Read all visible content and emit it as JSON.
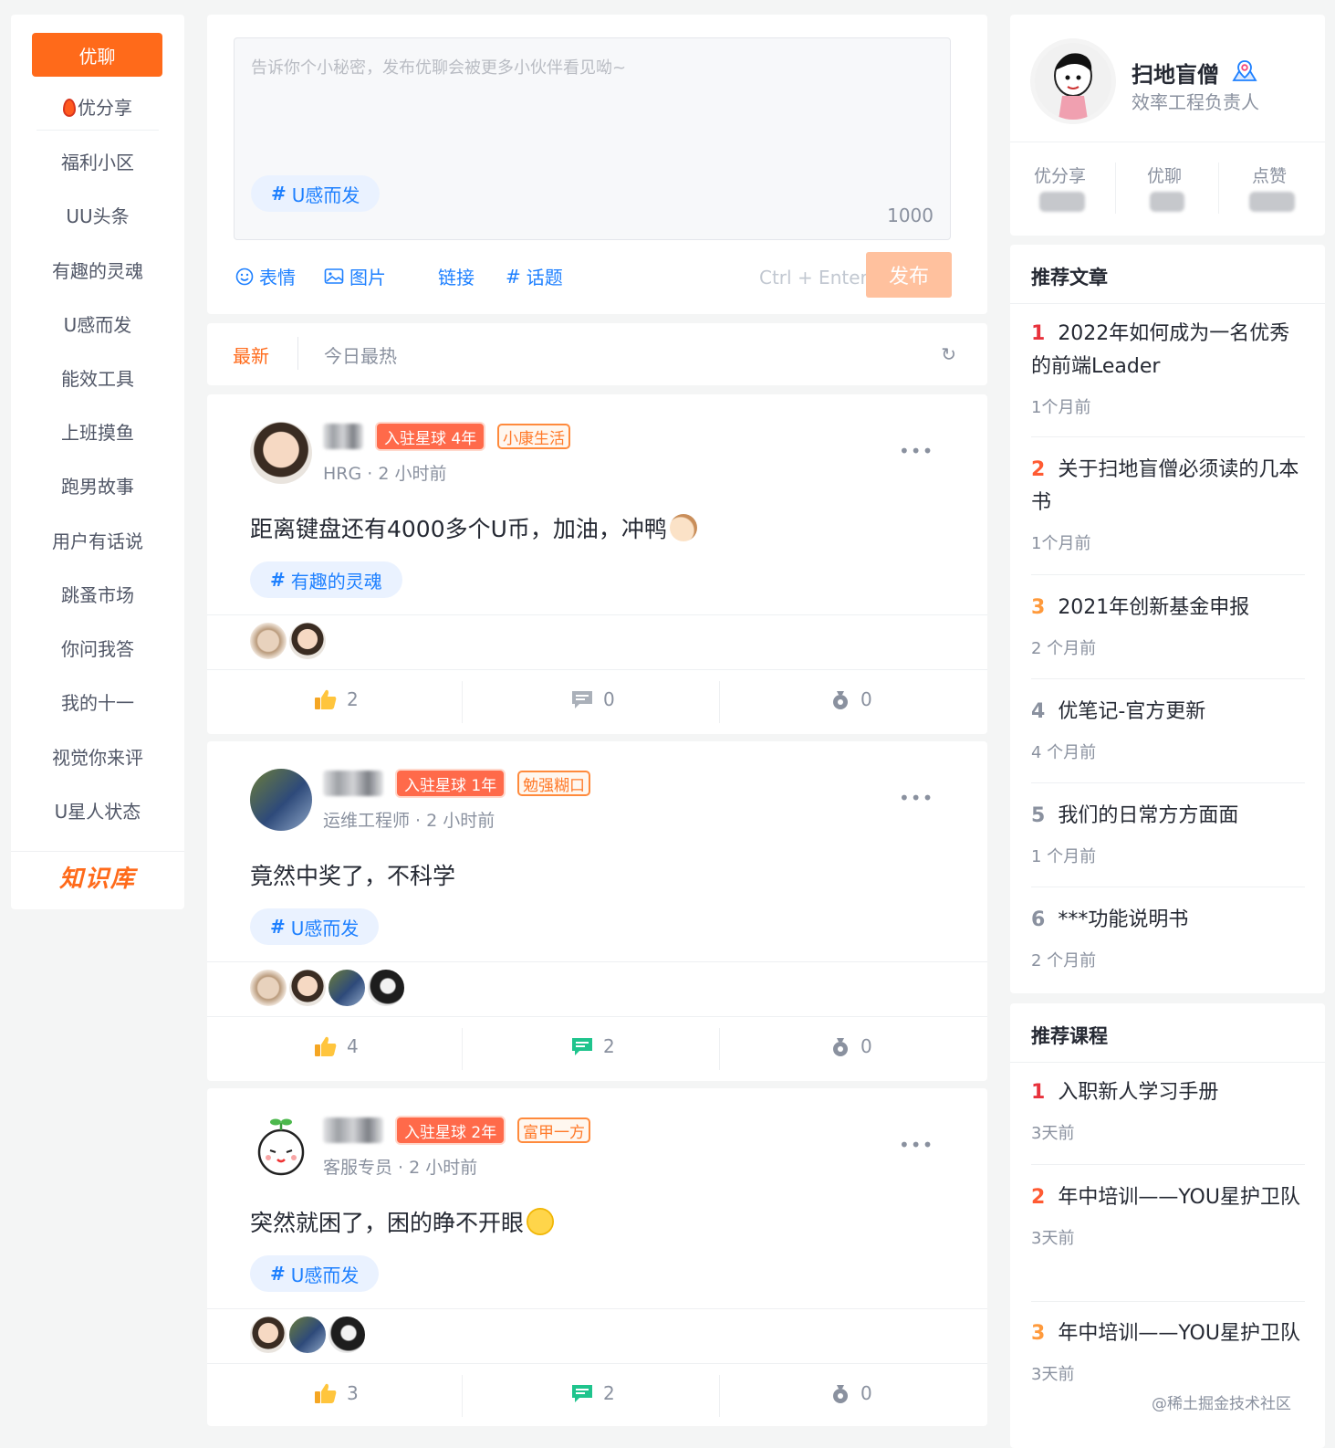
{
  "nav": {
    "active": "优聊",
    "items": [
      "优分享",
      "福利小区",
      "UU头条",
      "有趣的灵魂",
      "U感而发",
      "能效工具",
      "上班摸鱼",
      "跑男故事",
      "用户有话说",
      "跳蚤市场",
      "你问我答",
      "我的十一",
      "视觉你来评",
      "U星人状态"
    ],
    "knowledge_base": "知识库"
  },
  "composer": {
    "placeholder": "告诉你个小秘密，发布优聊会被更多小伙伴看见呦~",
    "topic": "U感而发",
    "char_count": "1000",
    "tools": [
      "表情",
      "图片",
      "链接",
      "话题"
    ],
    "shortcut": "Ctrl + Enter",
    "publish": "发布"
  },
  "tabs": {
    "active": "最新",
    "other": "今日最热"
  },
  "posts": [
    {
      "badge_years": "入驻星球 4年",
      "badge_level": "小康生活",
      "role": "HRG",
      "time": "2 小时前",
      "content": "距离键盘还有4000多个U币，加油，冲鸭",
      "topic": "有趣的灵魂",
      "likes": "2",
      "comments": "0",
      "shares": "0"
    },
    {
      "badge_years": "入驻星球 1年",
      "badge_level": "勉强糊口",
      "role": "运维工程师",
      "time": "2 小时前",
      "content": "竟然中奖了，不科学",
      "topic": "U感而发",
      "likes": "4",
      "comments": "2",
      "shares": "0"
    },
    {
      "badge_years": "入驻星球 2年",
      "badge_level": "富甲一方",
      "role": "客服专员",
      "time": "2 小时前",
      "content": "突然就困了，困的睁不开眼",
      "topic": "U感而发",
      "likes": "3",
      "comments": "2",
      "shares": "0"
    }
  ],
  "profile": {
    "name": "扫地盲僧",
    "title": "效率工程负责人",
    "stats": [
      "优分享",
      "优聊",
      "点赞"
    ]
  },
  "recommended_articles": {
    "title": "推荐文章",
    "items": [
      {
        "rank": "1",
        "title": "2022年如何成为一名优秀的前端Leader",
        "time": "1个月前"
      },
      {
        "rank": "2",
        "title": "关于扫地盲僧必须读的几本书",
        "time": "1个月前"
      },
      {
        "rank": "3",
        "title": "2021年创新基金申报",
        "time": "2 个月前"
      },
      {
        "rank": "4",
        "title": "优笔记-官方更新",
        "time": "4 个月前"
      },
      {
        "rank": "5",
        "title": "我们的日常方方面面",
        "time": "1 个月前"
      },
      {
        "rank": "6",
        "title": "***功能说明书",
        "time": "2 个月前"
      }
    ]
  },
  "recommended_courses": {
    "title": "推荐课程",
    "items": [
      {
        "rank": "1",
        "title": "入职新人学习手册",
        "time": "3天前"
      },
      {
        "rank": "2",
        "title": "年中培训——YOU星护卫队",
        "time": "3天前"
      },
      {
        "rank": "3",
        "title": "年中培训——YOU星护卫队",
        "time": "3天前"
      }
    ]
  },
  "watermark": "@稀土掘金技术社区",
  "colors": {
    "brand": "#ff6a1a",
    "link": "#1e80ff",
    "text": "#252933",
    "muted": "#8a919f",
    "background": "#f4f5f5"
  }
}
